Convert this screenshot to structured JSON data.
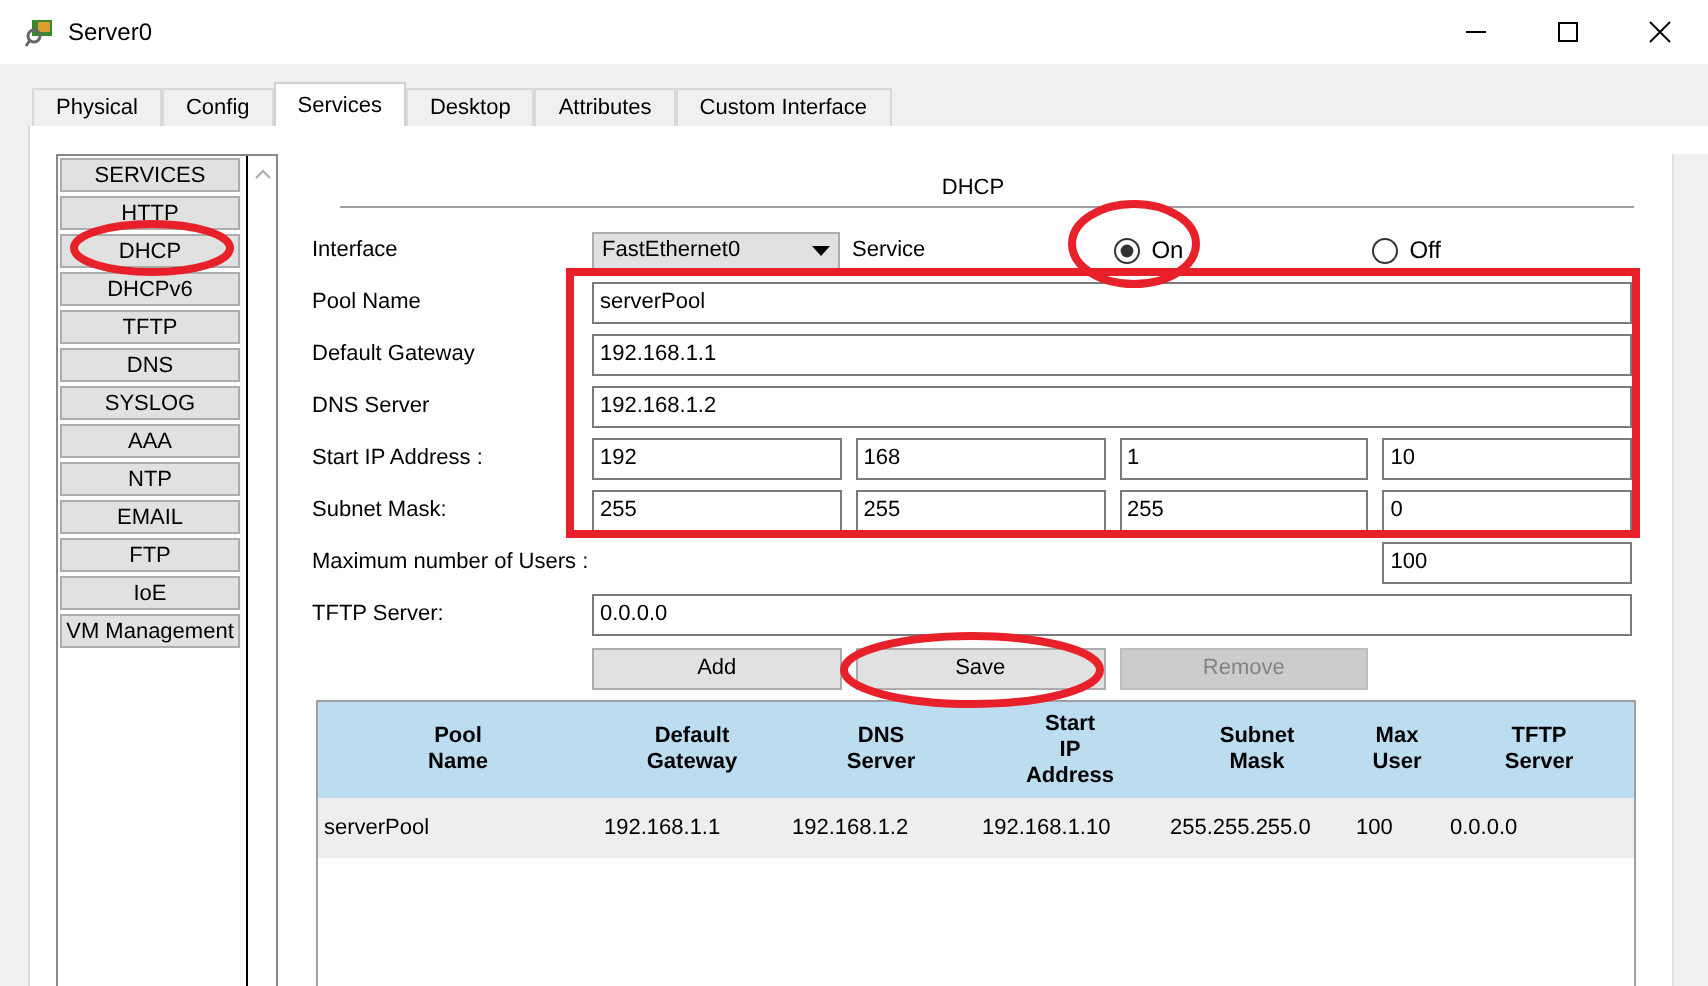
{
  "window": {
    "title": "Server0"
  },
  "tabs": [
    {
      "label": "Physical",
      "selected": false
    },
    {
      "label": "Config",
      "selected": false
    },
    {
      "label": "Services",
      "selected": true
    },
    {
      "label": "Desktop",
      "selected": false
    },
    {
      "label": "Attributes",
      "selected": false
    },
    {
      "label": "Custom Interface",
      "selected": false
    }
  ],
  "services": [
    {
      "label": "SERVICES"
    },
    {
      "label": "HTTP"
    },
    {
      "label": "DHCP"
    },
    {
      "label": "DHCPv6"
    },
    {
      "label": "TFTP"
    },
    {
      "label": "DNS"
    },
    {
      "label": "SYSLOG"
    },
    {
      "label": "AAA"
    },
    {
      "label": "NTP"
    },
    {
      "label": "EMAIL"
    },
    {
      "label": "FTP"
    },
    {
      "label": "IoE"
    },
    {
      "label": "VM Management"
    }
  ],
  "dhcp": {
    "heading": "DHCP",
    "interface": {
      "label": "Interface",
      "value": "FastEthernet0"
    },
    "service": {
      "label": "Service",
      "options": [
        {
          "label": "On",
          "selected": true
        },
        {
          "label": "Off",
          "selected": false
        }
      ]
    },
    "pool_name": {
      "label": "Pool Name",
      "value": "serverPool"
    },
    "default_gateway": {
      "label": "Default Gateway",
      "value": "192.168.1.1"
    },
    "dns_server": {
      "label": "DNS Server",
      "value": "192.168.1.2"
    },
    "start_ip": {
      "label": "Start IP Address :",
      "octets": [
        "192",
        "168",
        "1",
        "10"
      ]
    },
    "subnet_mask": {
      "label": "Subnet Mask:",
      "octets": [
        "255",
        "255",
        "255",
        "0"
      ]
    },
    "max_users": {
      "label": "Maximum number of Users :",
      "value": "100"
    },
    "tftp_server": {
      "label": "TFTP Server:",
      "value": "0.0.0.0"
    },
    "buttons": [
      {
        "label": "Add",
        "disabled": false
      },
      {
        "label": "Save",
        "disabled": false
      },
      {
        "label": "Remove",
        "disabled": true
      }
    ],
    "table": {
      "columns": [
        "Pool\nName",
        "Default\nGateway",
        "DNS\nServer",
        "Start\nIP\nAddress",
        "Subnet\nMask",
        "Max\nUser",
        "TFTP\nServer"
      ],
      "rows": [
        [
          "serverPool",
          "192.168.1.1",
          "192.168.1.2",
          "192.168.1.10",
          "255.255.255.0",
          "100",
          "0.0.0.0"
        ]
      ]
    }
  }
}
